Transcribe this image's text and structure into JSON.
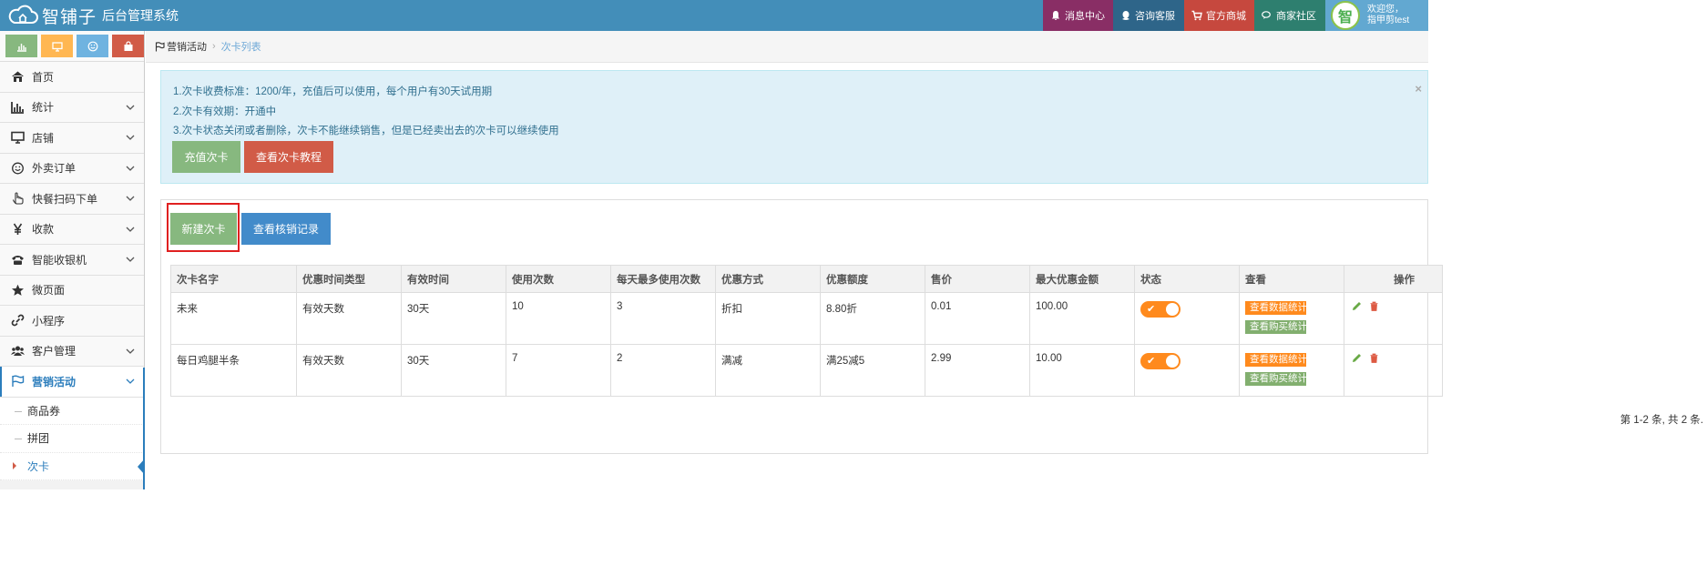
{
  "navbar": {
    "brand": "智铺子",
    "subtitle": "后台管理系统",
    "buttons": [
      {
        "label": "消息中心",
        "icon": "bell-icon",
        "color": "#892e65"
      },
      {
        "label": "咨询客服",
        "icon": "qq-icon",
        "color": "#2e6589"
      },
      {
        "label": "官方商城",
        "icon": "cart-icon",
        "color": "#c6483e"
      },
      {
        "label": "商家社区",
        "icon": "comments-icon",
        "color": "#2e7f6f"
      }
    ],
    "user": {
      "avatar_text": "智",
      "welcome": "欢迎您，",
      "name": "指甲剪test"
    }
  },
  "sidebar": {
    "shortcuts": [
      "chart-icon",
      "desktop-icon",
      "smile-icon",
      "bag-icon"
    ],
    "items": [
      {
        "label": "首页",
        "icon": "home-icon"
      },
      {
        "label": "统计",
        "icon": "bar-chart-icon"
      },
      {
        "label": "店铺",
        "icon": "desktop-icon"
      },
      {
        "label": "外卖订单",
        "icon": "smile-icon"
      },
      {
        "label": "快餐扫码下单",
        "icon": "hand-pointer-icon"
      },
      {
        "label": "收款",
        "icon": "yen-icon"
      },
      {
        "label": "智能收银机",
        "icon": "phone-icon"
      },
      {
        "label": "微页面",
        "icon": "star-icon"
      },
      {
        "label": "小程序",
        "icon": "link-icon"
      },
      {
        "label": "客户管理",
        "icon": "users-icon"
      },
      {
        "label": "营销活动",
        "icon": "flag-icon"
      }
    ],
    "submenu": [
      "商品券",
      "拼团",
      "次卡"
    ]
  },
  "breadcrumb": {
    "parent": "营销活动",
    "current": "次卡列表"
  },
  "alert": {
    "lines": [
      "1.次卡收费标准：1200/年，充值后可以使用，每个用户有30天试用期",
      "2.次卡有效期：开通中",
      "3.次卡状态关闭或者删除，次卡不能继续销售，但是已经卖出去的次卡可以继续使用"
    ],
    "recharge_btn": "充值次卡",
    "tutorial_btn": "查看次卡教程",
    "close": "×"
  },
  "actions": {
    "new_btn": "新建次卡",
    "records_btn": "查看核销记录"
  },
  "table": {
    "headers": [
      "次卡名字",
      "优惠时间类型",
      "有效时间",
      "使用次数",
      "每天最多使用次数",
      "优惠方式",
      "优惠额度",
      "售价",
      "最大优惠金额",
      "状态",
      "查看",
      "操作"
    ],
    "rows": [
      {
        "name": "未来",
        "time_type": "有效天数",
        "valid": "30天",
        "uses": "10",
        "daily_max": "3",
        "method": "折扣",
        "amount": "8.80折",
        "price": "0.01",
        "max_discount": "100.00",
        "status_on": true
      },
      {
        "name": "每日鸡腿半条",
        "time_type": "有效天数",
        "valid": "30天",
        "uses": "7",
        "daily_max": "2",
        "method": "满减",
        "amount": "满25减5",
        "price": "2.99",
        "max_discount": "10.00",
        "status_on": true
      }
    ],
    "view_data_btn": "查看数据统计",
    "view_buy_btn": "查看购买统计"
  },
  "pager": "第 1-2 条, 共 2 条.",
  "colors": {
    "navbar": "#438eb9",
    "accent": "#2b7dbc",
    "toggle": "#ff8a1d",
    "highlight": "#e02020"
  }
}
